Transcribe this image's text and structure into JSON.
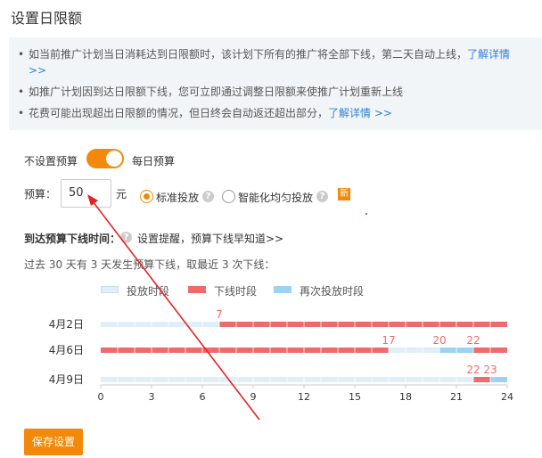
{
  "dialog": {
    "title": "设置日限额"
  },
  "info": {
    "items": [
      {
        "text": "如当前推广计划当日消耗达到日限额时，该计划下所有的推广将全部下线，第二天自动上线，",
        "link": "了解详情 >>"
      },
      {
        "text": "如推广计划因到达日限额下线，您可立即通过调整日限额来使推广计划重新上线",
        "link": ""
      },
      {
        "text": "花费可能出现超出日限额的情况，但日终会自动返还超出部分，",
        "link": "了解详情 >>"
      }
    ]
  },
  "budget_toggle": {
    "off_label": "不设置预算",
    "on_label": "每日预算",
    "enabled": true
  },
  "budget": {
    "label": "预算：",
    "value": "50",
    "unit": "元"
  },
  "delivery": {
    "options": [
      {
        "label": "标准投放",
        "selected": true
      },
      {
        "label": "智能化均匀投放",
        "selected": false
      }
    ],
    "new_badge": "新"
  },
  "offline_section": {
    "title": "到达预算下线时间：",
    "link": "设置提醒，预算下线早知道>>",
    "summary": "过去 30 天有 3 天发生预算下线，取最近 3 次下线："
  },
  "colors": {
    "accent": "#f2890a",
    "normal": "#dfeef8",
    "offline": "#ef6b6b",
    "resume": "#9dd2f2",
    "link": "#2f7fd6"
  },
  "chart_data": {
    "type": "bar",
    "orientation": "horizontal",
    "legend": [
      {
        "name": "投放时段",
        "color": "#dfeef8"
      },
      {
        "name": "下线时段",
        "color": "#ef6b6b"
      },
      {
        "name": "再次投放时段",
        "color": "#9dd2f2"
      }
    ],
    "x_ticks": [
      0,
      3,
      6,
      9,
      12,
      15,
      18,
      21,
      24
    ],
    "xlim": [
      0,
      24
    ],
    "rows": [
      {
        "date": "4月2日",
        "segments": [
          {
            "type": "投放时段",
            "start": 0,
            "end": 7
          },
          {
            "type": "下线时段",
            "start": 7,
            "end": 24
          }
        ],
        "labels": [
          "7"
        ],
        "label_positions": [
          7
        ]
      },
      {
        "date": "4月6日",
        "segments": [
          {
            "type": "下线时段",
            "start": 0,
            "end": 17
          },
          {
            "type": "投放时段",
            "start": 17,
            "end": 20
          },
          {
            "type": "再次投放时段",
            "start": 20,
            "end": 22
          },
          {
            "type": "下线时段",
            "start": 22,
            "end": 24
          }
        ],
        "labels": [
          "17",
          "20",
          "22"
        ],
        "label_positions": [
          17,
          20,
          22
        ]
      },
      {
        "date": "4月9日",
        "segments": [
          {
            "type": "投放时段",
            "start": 0,
            "end": 22
          },
          {
            "type": "下线时段",
            "start": 22,
            "end": 23
          },
          {
            "type": "再次投放时段",
            "start": 23,
            "end": 24
          }
        ],
        "labels": [
          "22",
          "23"
        ],
        "label_positions": [
          22,
          23
        ]
      }
    ]
  },
  "save_button": {
    "label": "保存设置"
  }
}
